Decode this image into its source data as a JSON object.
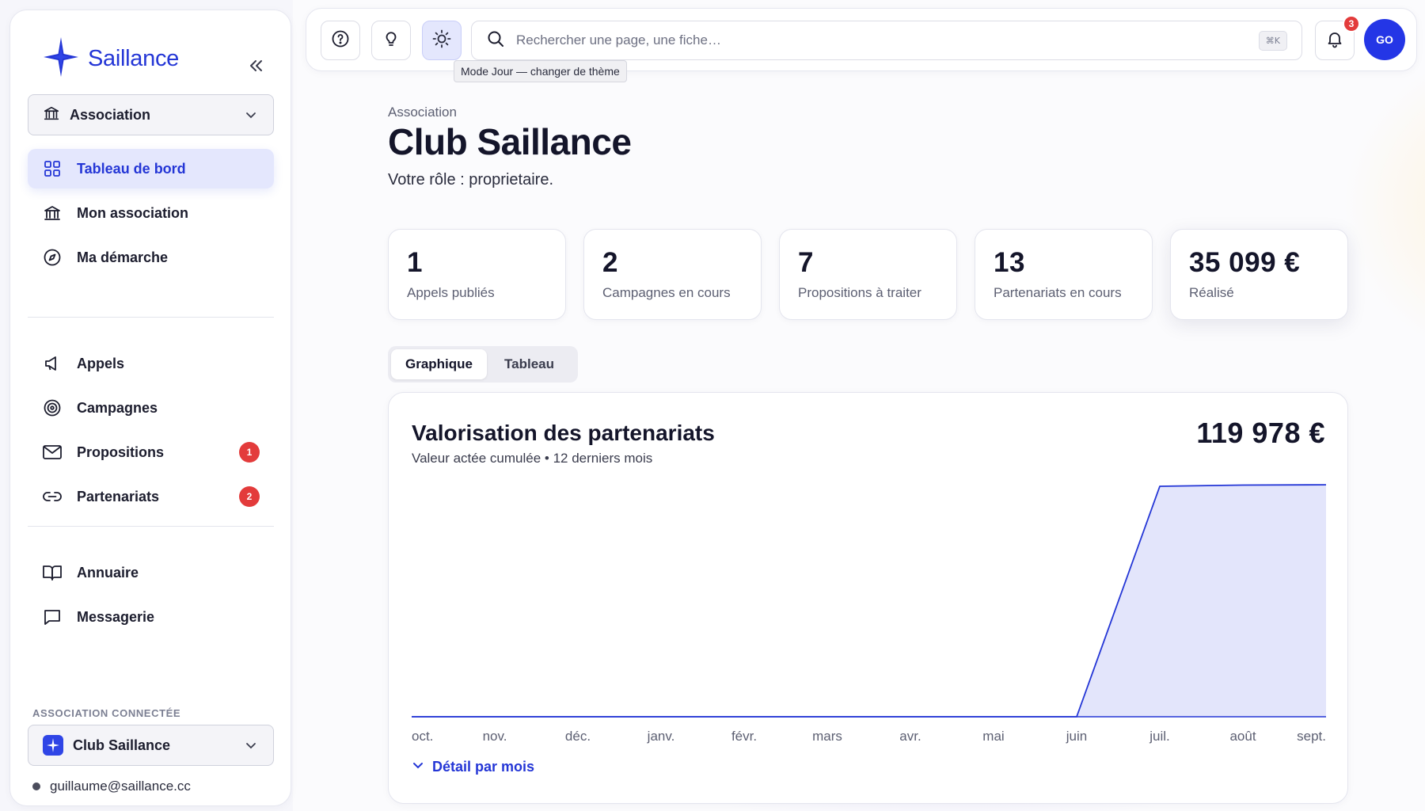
{
  "app": {
    "name": "Saillance"
  },
  "sidebar": {
    "collapse_icon": "double-chevron-left-icon",
    "org_switcher": {
      "label": "Association",
      "icon": "institution-icon"
    },
    "nav_primary": [
      {
        "label": "Tableau de bord",
        "icon": "grid-icon",
        "active": true
      },
      {
        "label": "Mon association",
        "icon": "institution-icon"
      },
      {
        "label": "Ma démarche",
        "icon": "compass-icon"
      }
    ],
    "nav_secondary": [
      {
        "label": "Appels",
        "icon": "megaphone-icon"
      },
      {
        "label": "Campagnes",
        "icon": "target-icon"
      },
      {
        "label": "Propositions",
        "icon": "mail-icon",
        "badge": "1"
      },
      {
        "label": "Partenariats",
        "icon": "link-icon",
        "badge": "2"
      }
    ],
    "nav_tertiary": [
      {
        "label": "Annuaire",
        "icon": "book-icon"
      },
      {
        "label": "Messagerie",
        "icon": "chat-icon"
      }
    ],
    "connected_label": "ASSOCIATION CONNECTÉE",
    "connected_org": "Club Saillance",
    "user_email": "guillaume@saillance.cc"
  },
  "topbar": {
    "search_placeholder": "Rechercher une page, une fiche…",
    "search_shortcut": "⌘K",
    "theme_tooltip": "Mode Jour — changer de thème",
    "notifications_count": "3",
    "avatar_initials": "GO"
  },
  "page": {
    "breadcrumb": "Association",
    "title": "Club Saillance",
    "role_text": "Votre rôle : proprietaire."
  },
  "stats": [
    {
      "value": "1",
      "label": "Appels publiés"
    },
    {
      "value": "2",
      "label": "Campagnes en cours"
    },
    {
      "value": "7",
      "label": "Propositions à traiter"
    },
    {
      "value": "13",
      "label": "Partenariats en cours"
    },
    {
      "value": "35 099 €",
      "label": "Réalisé"
    }
  ],
  "view_tabs": [
    {
      "label": "Graphique",
      "active": true
    },
    {
      "label": "Tableau"
    }
  ],
  "chart": {
    "title": "Valorisation des partenariats",
    "subtitle": "Valeur actée cumulée • 12 derniers mois",
    "total": "119 978 €",
    "detail_link": "Détail par mois"
  },
  "colors": {
    "accent": "#2436d6",
    "badge": "#e33b3b",
    "area_fill": "#e3e5fb"
  },
  "chart_data": {
    "type": "area",
    "categories": [
      "oct.",
      "nov.",
      "déc.",
      "janv.",
      "févr.",
      "mars",
      "avr.",
      "mai",
      "juin",
      "juil.",
      "août",
      "sept."
    ],
    "values": [
      0,
      0,
      0,
      0,
      0,
      0,
      0,
      0,
      0,
      119178,
      119778,
      119978
    ],
    "title": "Valorisation des partenariats",
    "ylim": [
      0,
      120000
    ],
    "grid": false,
    "legend": "none"
  }
}
